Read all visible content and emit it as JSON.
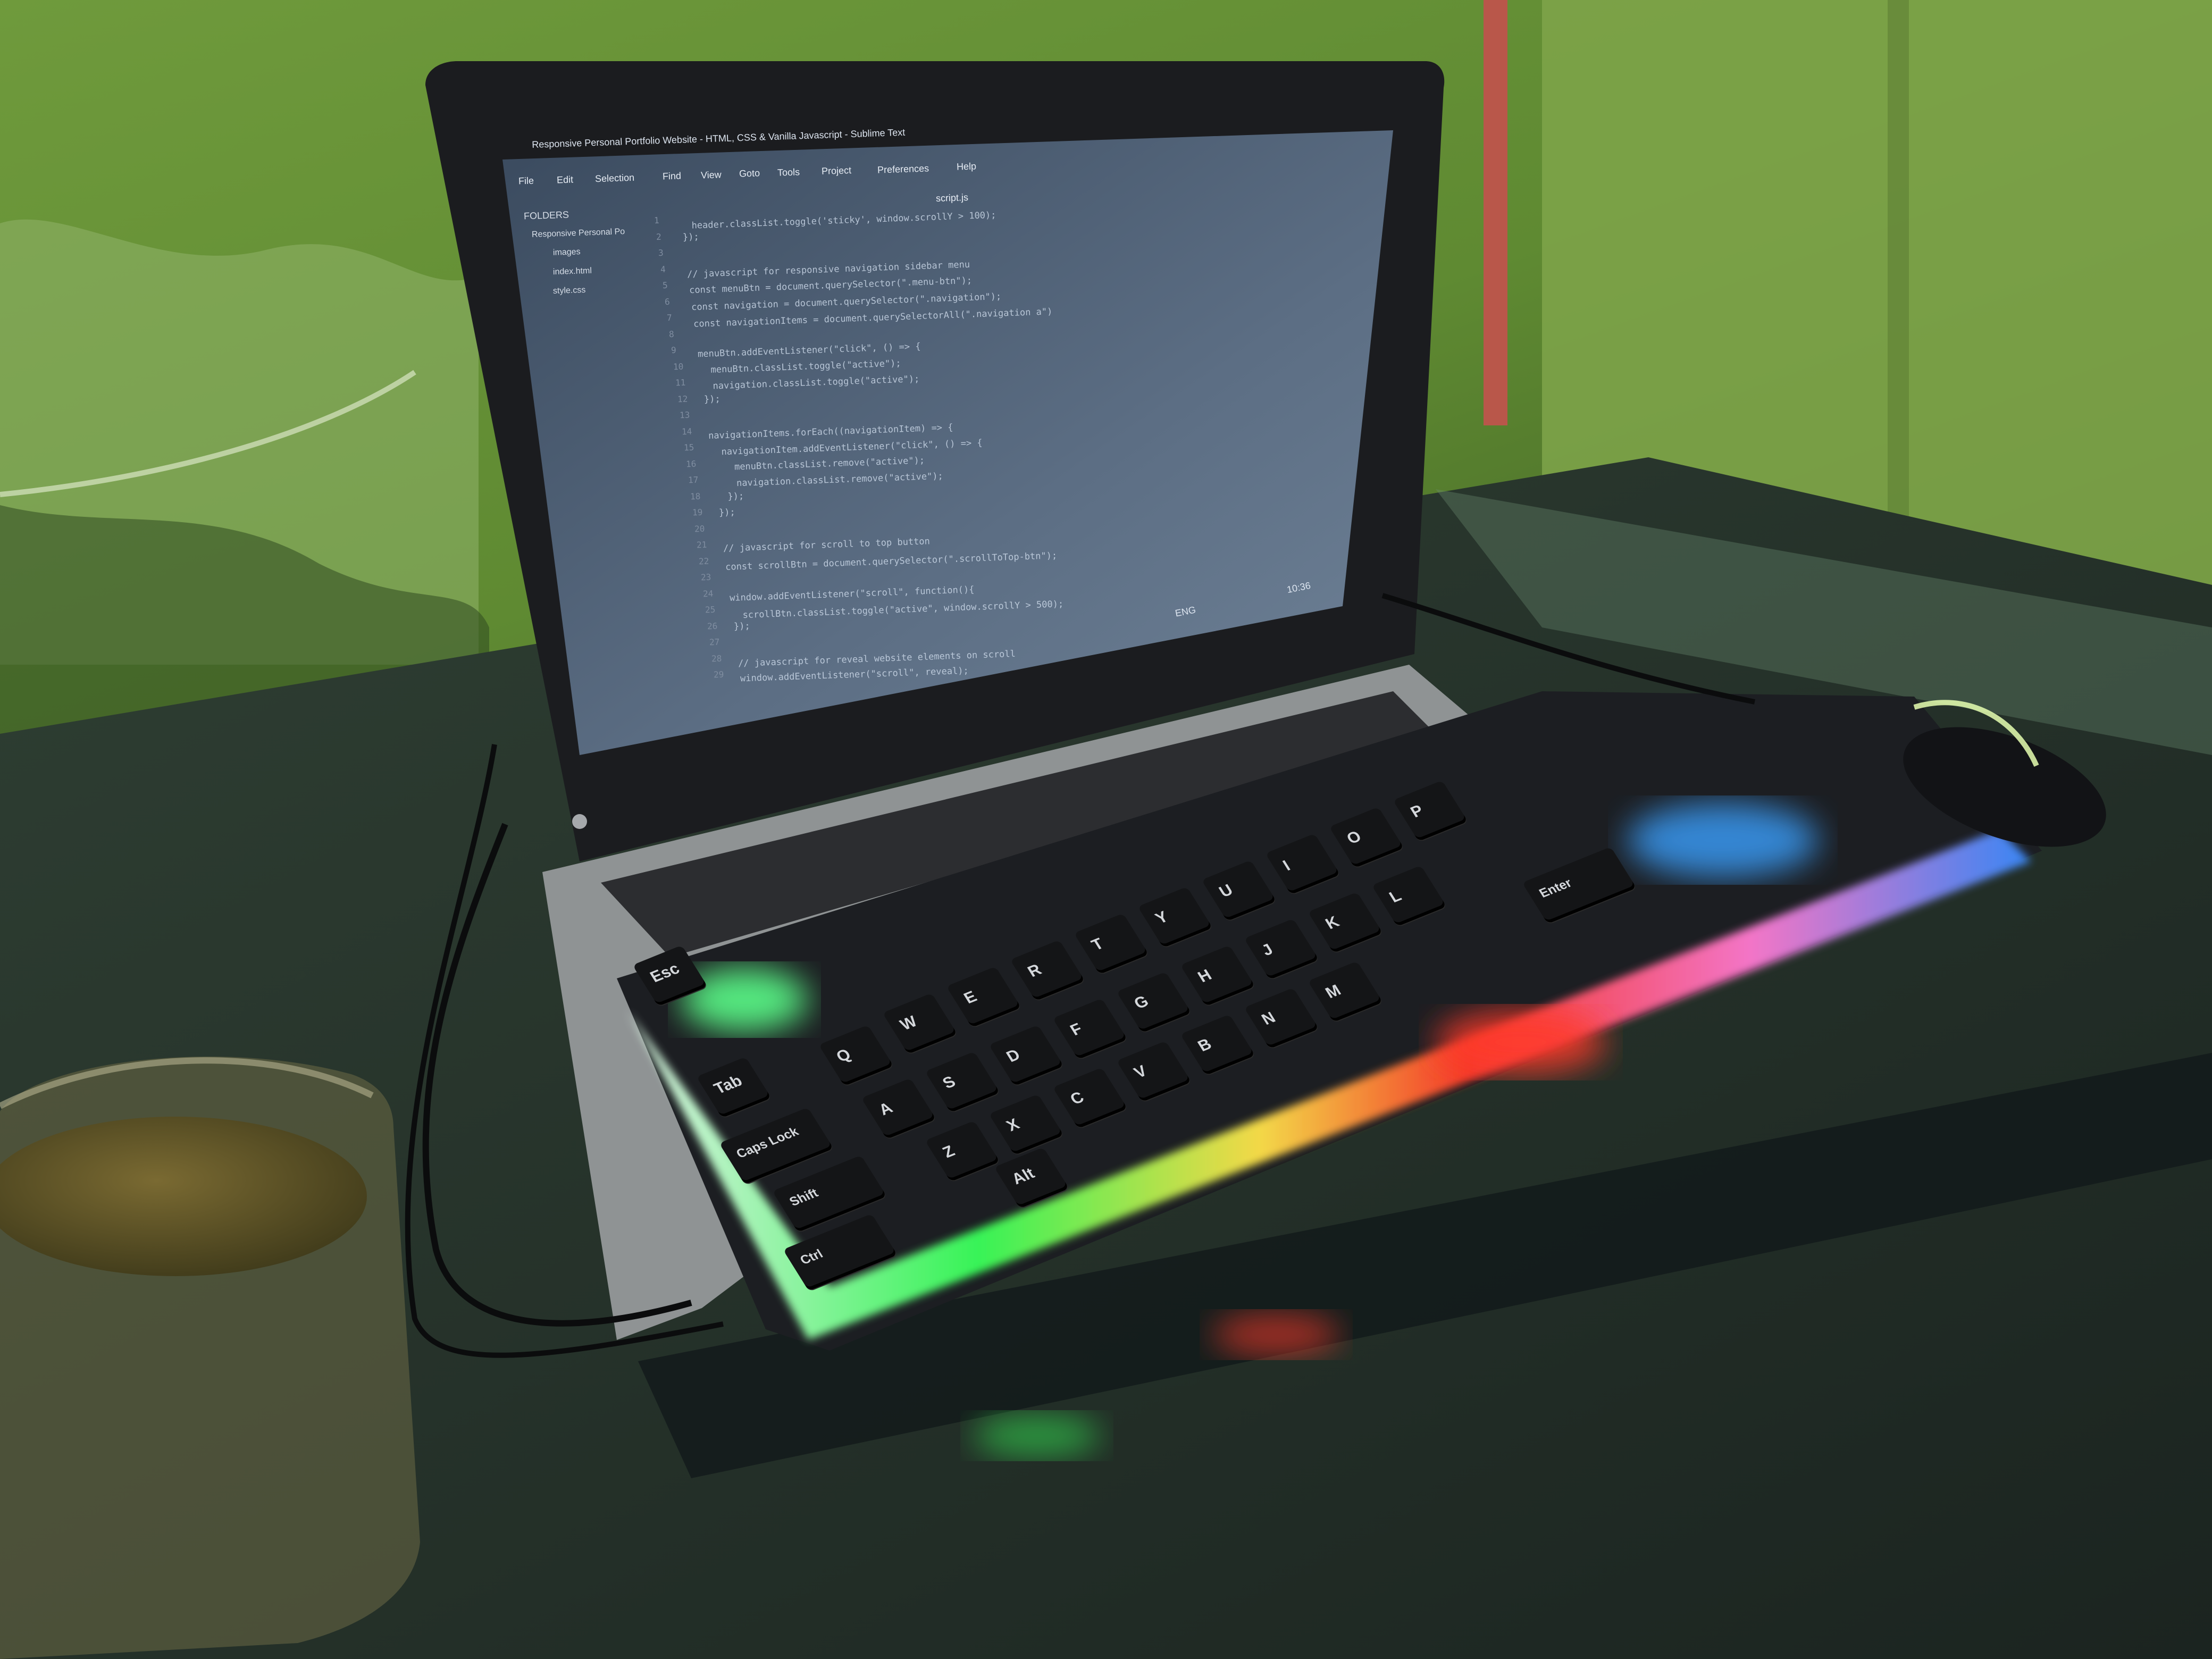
{
  "editor": {
    "title_bar": "Responsive Personal Portfolio Website - HTML, CSS & Vanilla Javascript - Sublime Text",
    "menu": [
      "File",
      "Edit",
      "Selection",
      "Find",
      "View",
      "Goto",
      "Tools",
      "Project",
      "Preferences",
      "Help"
    ],
    "sidebar_header": "FOLDERS",
    "sidebar_items": [
      "Responsive Personal Po",
      "images",
      "index.html",
      "style.css"
    ],
    "tab": "script.js",
    "code_lines": [
      "  header.classList.toggle('sticky', window.scrollY > 100);",
      "});",
      "",
      "// javascript for responsive navigation sidebar menu",
      "const menuBtn = document.querySelector(\".menu-btn\");",
      "const navigation = document.querySelector(\".navigation\");",
      "const navigationItems = document.querySelectorAll(\".navigation a\")",
      "",
      "menuBtn.addEventListener(\"click\", () => {",
      "  menuBtn.classList.toggle(\"active\");",
      "  navigation.classList.toggle(\"active\");",
      "});",
      "",
      "navigationItems.forEach((navigationItem) => {",
      "  navigationItem.addEventListener(\"click\", () => {",
      "    menuBtn.classList.remove(\"active\");",
      "    navigation.classList.remove(\"active\");",
      "  });",
      "});",
      "",
      "// javascript for scroll to top button",
      "const scrollBtn = document.querySelector(\".scrollToTop-btn\");",
      "",
      "window.addEventListener(\"scroll\", function(){",
      "  scrollBtn.classList.toggle(\"active\", window.scrollY > 500);",
      "});",
      "",
      "// javascript for reveal website elements on scroll",
      "window.addEventListener(\"scroll\", reveal);"
    ]
  },
  "taskbar": {
    "lang": "ENG",
    "clock": "10:36"
  },
  "keyboard": {
    "labels": [
      "Esc",
      "Tab",
      "Caps Lock",
      "Shift",
      "Ctrl",
      "Alt",
      "Q",
      "W",
      "E",
      "R",
      "T",
      "Y",
      "U",
      "I",
      "O",
      "P",
      "A",
      "S",
      "D",
      "F",
      "G",
      "H",
      "J",
      "K",
      "L",
      "Z",
      "X",
      "C",
      "V",
      "B",
      "N",
      "M",
      "Enter"
    ]
  }
}
